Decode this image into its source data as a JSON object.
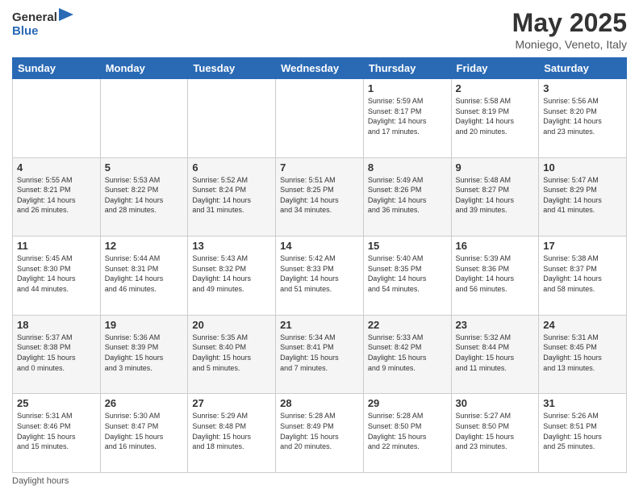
{
  "header": {
    "logo_general": "General",
    "logo_blue": "Blue",
    "month_title": "May 2025",
    "location": "Moniego, Veneto, Italy"
  },
  "days_of_week": [
    "Sunday",
    "Monday",
    "Tuesday",
    "Wednesday",
    "Thursday",
    "Friday",
    "Saturday"
  ],
  "weeks": [
    [
      {
        "day": "",
        "info": ""
      },
      {
        "day": "",
        "info": ""
      },
      {
        "day": "",
        "info": ""
      },
      {
        "day": "",
        "info": ""
      },
      {
        "day": "1",
        "info": "Sunrise: 5:59 AM\nSunset: 8:17 PM\nDaylight: 14 hours\nand 17 minutes."
      },
      {
        "day": "2",
        "info": "Sunrise: 5:58 AM\nSunset: 8:19 PM\nDaylight: 14 hours\nand 20 minutes."
      },
      {
        "day": "3",
        "info": "Sunrise: 5:56 AM\nSunset: 8:20 PM\nDaylight: 14 hours\nand 23 minutes."
      }
    ],
    [
      {
        "day": "4",
        "info": "Sunrise: 5:55 AM\nSunset: 8:21 PM\nDaylight: 14 hours\nand 26 minutes."
      },
      {
        "day": "5",
        "info": "Sunrise: 5:53 AM\nSunset: 8:22 PM\nDaylight: 14 hours\nand 28 minutes."
      },
      {
        "day": "6",
        "info": "Sunrise: 5:52 AM\nSunset: 8:24 PM\nDaylight: 14 hours\nand 31 minutes."
      },
      {
        "day": "7",
        "info": "Sunrise: 5:51 AM\nSunset: 8:25 PM\nDaylight: 14 hours\nand 34 minutes."
      },
      {
        "day": "8",
        "info": "Sunrise: 5:49 AM\nSunset: 8:26 PM\nDaylight: 14 hours\nand 36 minutes."
      },
      {
        "day": "9",
        "info": "Sunrise: 5:48 AM\nSunset: 8:27 PM\nDaylight: 14 hours\nand 39 minutes."
      },
      {
        "day": "10",
        "info": "Sunrise: 5:47 AM\nSunset: 8:29 PM\nDaylight: 14 hours\nand 41 minutes."
      }
    ],
    [
      {
        "day": "11",
        "info": "Sunrise: 5:45 AM\nSunset: 8:30 PM\nDaylight: 14 hours\nand 44 minutes."
      },
      {
        "day": "12",
        "info": "Sunrise: 5:44 AM\nSunset: 8:31 PM\nDaylight: 14 hours\nand 46 minutes."
      },
      {
        "day": "13",
        "info": "Sunrise: 5:43 AM\nSunset: 8:32 PM\nDaylight: 14 hours\nand 49 minutes."
      },
      {
        "day": "14",
        "info": "Sunrise: 5:42 AM\nSunset: 8:33 PM\nDaylight: 14 hours\nand 51 minutes."
      },
      {
        "day": "15",
        "info": "Sunrise: 5:40 AM\nSunset: 8:35 PM\nDaylight: 14 hours\nand 54 minutes."
      },
      {
        "day": "16",
        "info": "Sunrise: 5:39 AM\nSunset: 8:36 PM\nDaylight: 14 hours\nand 56 minutes."
      },
      {
        "day": "17",
        "info": "Sunrise: 5:38 AM\nSunset: 8:37 PM\nDaylight: 14 hours\nand 58 minutes."
      }
    ],
    [
      {
        "day": "18",
        "info": "Sunrise: 5:37 AM\nSunset: 8:38 PM\nDaylight: 15 hours\nand 0 minutes."
      },
      {
        "day": "19",
        "info": "Sunrise: 5:36 AM\nSunset: 8:39 PM\nDaylight: 15 hours\nand 3 minutes."
      },
      {
        "day": "20",
        "info": "Sunrise: 5:35 AM\nSunset: 8:40 PM\nDaylight: 15 hours\nand 5 minutes."
      },
      {
        "day": "21",
        "info": "Sunrise: 5:34 AM\nSunset: 8:41 PM\nDaylight: 15 hours\nand 7 minutes."
      },
      {
        "day": "22",
        "info": "Sunrise: 5:33 AM\nSunset: 8:42 PM\nDaylight: 15 hours\nand 9 minutes."
      },
      {
        "day": "23",
        "info": "Sunrise: 5:32 AM\nSunset: 8:44 PM\nDaylight: 15 hours\nand 11 minutes."
      },
      {
        "day": "24",
        "info": "Sunrise: 5:31 AM\nSunset: 8:45 PM\nDaylight: 15 hours\nand 13 minutes."
      }
    ],
    [
      {
        "day": "25",
        "info": "Sunrise: 5:31 AM\nSunset: 8:46 PM\nDaylight: 15 hours\nand 15 minutes."
      },
      {
        "day": "26",
        "info": "Sunrise: 5:30 AM\nSunset: 8:47 PM\nDaylight: 15 hours\nand 16 minutes."
      },
      {
        "day": "27",
        "info": "Sunrise: 5:29 AM\nSunset: 8:48 PM\nDaylight: 15 hours\nand 18 minutes."
      },
      {
        "day": "28",
        "info": "Sunrise: 5:28 AM\nSunset: 8:49 PM\nDaylight: 15 hours\nand 20 minutes."
      },
      {
        "day": "29",
        "info": "Sunrise: 5:28 AM\nSunset: 8:50 PM\nDaylight: 15 hours\nand 22 minutes."
      },
      {
        "day": "30",
        "info": "Sunrise: 5:27 AM\nSunset: 8:50 PM\nDaylight: 15 hours\nand 23 minutes."
      },
      {
        "day": "31",
        "info": "Sunrise: 5:26 AM\nSunset: 8:51 PM\nDaylight: 15 hours\nand 25 minutes."
      }
    ]
  ],
  "footer": {
    "note": "Daylight hours"
  }
}
